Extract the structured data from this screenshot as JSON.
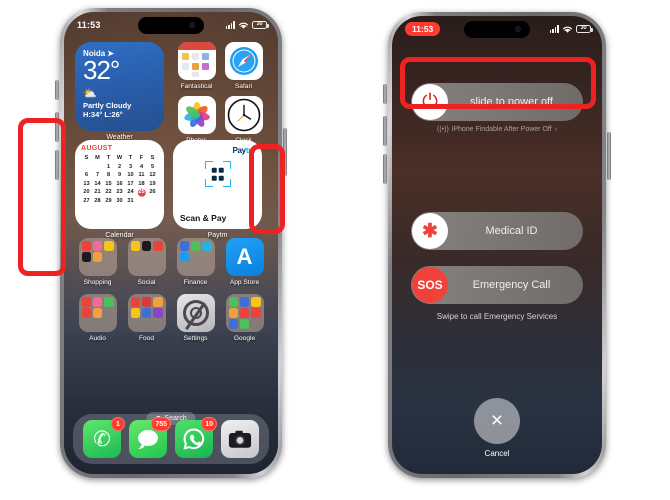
{
  "left_phone": {
    "name": "iphone-home-screen",
    "statusbar": {
      "time": "11:53",
      "signal_icon": "cellular-bars-icon",
      "wifi_icon": "wifi-icon",
      "battery_level": "30"
    },
    "weather_widget": {
      "city": "Noida",
      "location_arrow_icon": "location-arrow-icon",
      "temperature": "32°",
      "condition_icon": "partly-cloudy-icon",
      "condition": "Partly Cloudy",
      "high_low": "H:34° L:26°",
      "label": "Weather"
    },
    "calendar_widget": {
      "month": "AUGUST",
      "weekday_headers": [
        "S",
        "M",
        "T",
        "W",
        "T",
        "F",
        "S"
      ],
      "weeks": [
        [
          "",
          "",
          "1",
          "2",
          "3",
          "4",
          "5"
        ],
        [
          "6",
          "7",
          "8",
          "9",
          "10",
          "11",
          "12"
        ],
        [
          "13",
          "14",
          "15",
          "16",
          "17",
          "18",
          "19"
        ],
        [
          "20",
          "21",
          "22",
          "23",
          "24",
          "25",
          "26"
        ],
        [
          "27",
          "28",
          "29",
          "30",
          "31",
          "",
          ""
        ]
      ],
      "today": "25",
      "label": "Calendar"
    },
    "paytm_widget": {
      "logo_part1": "Pay",
      "logo_part2": "tm",
      "qr_icon": "qr-scan-icon",
      "action": "Scan & Pay",
      "label": "Paytm"
    },
    "apps": [
      {
        "label": "Shopping",
        "type": "folder"
      },
      {
        "label": "Social",
        "type": "folder"
      },
      {
        "label": "Finance",
        "type": "folder"
      },
      {
        "label": "App Store",
        "type": "app",
        "icon": "app-store-icon",
        "glyph": "A"
      },
      {
        "label": "Audio",
        "type": "folder"
      },
      {
        "label": "Food",
        "type": "folder"
      },
      {
        "label": "Settings",
        "type": "app",
        "icon": "settings-gear-icon",
        "glyph": ""
      },
      {
        "label": "Google",
        "type": "folder"
      }
    ],
    "top_apps": [
      {
        "label": "Fantastical",
        "icon": "fantastical-icon"
      },
      {
        "label": "Safari",
        "icon": "safari-compass-icon"
      },
      {
        "label": "Photos",
        "icon": "photos-pinwheel-icon"
      },
      {
        "label": "Clock",
        "icon": "clock-face-icon"
      }
    ],
    "search": {
      "label": "Search",
      "icon": "search-icon"
    },
    "dock": [
      {
        "name": "phone",
        "icon": "phone-handset-icon",
        "glyph": "✆",
        "badge": "1"
      },
      {
        "name": "messages",
        "icon": "messages-bubble-icon",
        "glyph": "💬",
        "badge": "755"
      },
      {
        "name": "whatsapp",
        "icon": "whatsapp-icon",
        "glyph": "✆",
        "badge": "10"
      },
      {
        "name": "camera",
        "icon": "camera-icon",
        "glyph": "📷",
        "badge": ""
      }
    ]
  },
  "right_phone": {
    "name": "iphone-power-off-screen",
    "statusbar": {
      "time": "11:53",
      "signal_icon": "cellular-bars-icon",
      "wifi_icon": "wifi-icon",
      "battery_level": "30"
    },
    "power_slider": {
      "icon": "power-symbol-icon",
      "label": "slide to power off"
    },
    "findable_note": {
      "icon": "findmy-broadcast-icon",
      "text": "iPhone Findable After Power Off",
      "chevron": "›"
    },
    "medical_slider": {
      "icon": "medical-id-asterisk-icon",
      "glyph": "✱",
      "label": "Medical ID"
    },
    "sos_slider": {
      "icon": "sos-icon",
      "glyph": "SOS",
      "label": "Emergency Call"
    },
    "swipe_note": "Swipe to call Emergency Services",
    "cancel": {
      "icon": "close-x-icon",
      "glyph": "×",
      "label": "Cancel"
    }
  },
  "annotations": [
    {
      "name": "volume-buttons-highlight",
      "color": "#ee2222"
    },
    {
      "name": "side-power-button-highlight",
      "color": "#ee2222"
    },
    {
      "name": "slide-to-power-off-highlight",
      "color": "#ee2222"
    }
  ],
  "theme": {
    "annotation_red": "#ee2222",
    "ios_red": "#ff3b30",
    "sos_red": "#f0413a",
    "calendar_red": "#e8483c",
    "appstore_blue": "#0b7fe0",
    "paytm_navy": "#002970",
    "paytm_cyan": "#20b6ef"
  }
}
